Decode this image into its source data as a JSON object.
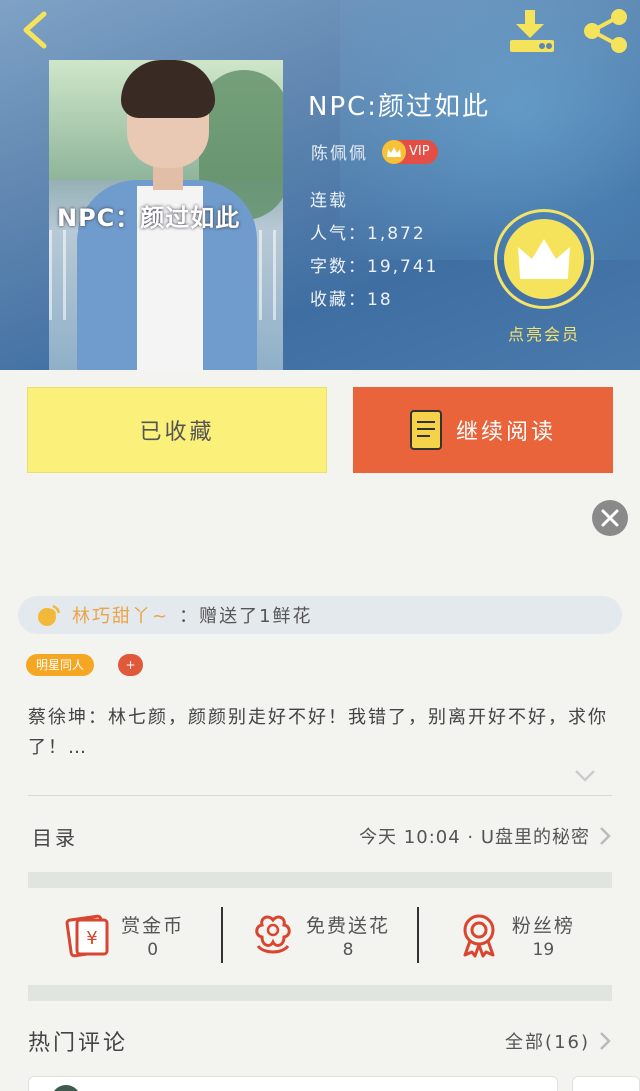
{
  "header": {
    "book_title": "NPC:颜过如此",
    "author": "陈佩佩",
    "vip_label": "VIP",
    "cover_text": "NPC：颜过如此",
    "status": "连载",
    "popularity": "人气：1,872",
    "word_count": "字数：19,741",
    "collections": "收藏：18",
    "member_label": "点亮会员",
    "accent_color": "#f5e35c"
  },
  "actions": {
    "favorited_label": "已收藏",
    "continue_label": "继续阅读"
  },
  "gift_notice": {
    "user": "林巧甜丫~",
    "text": "：赠送了1鲜花"
  },
  "tags": [
    "明星同人",
    "+"
  ],
  "synopsis": "蔡徐坤：林七颜，颜颜别走好不好！我错了，别离开好不好，求你了！…",
  "toc": {
    "label": "目录",
    "latest": "今天 10:04 · U盘里的秘密"
  },
  "stats": [
    {
      "icon": "red-envelope-icon",
      "label": "赏金币",
      "value": "0"
    },
    {
      "icon": "flower-icon",
      "label": "免费送花",
      "value": "8"
    },
    {
      "icon": "ribbon-badge-icon",
      "label": "粉丝榜",
      "value": "19"
    }
  ],
  "comments": {
    "title": "热门评论",
    "all_label": "全部(16)"
  }
}
